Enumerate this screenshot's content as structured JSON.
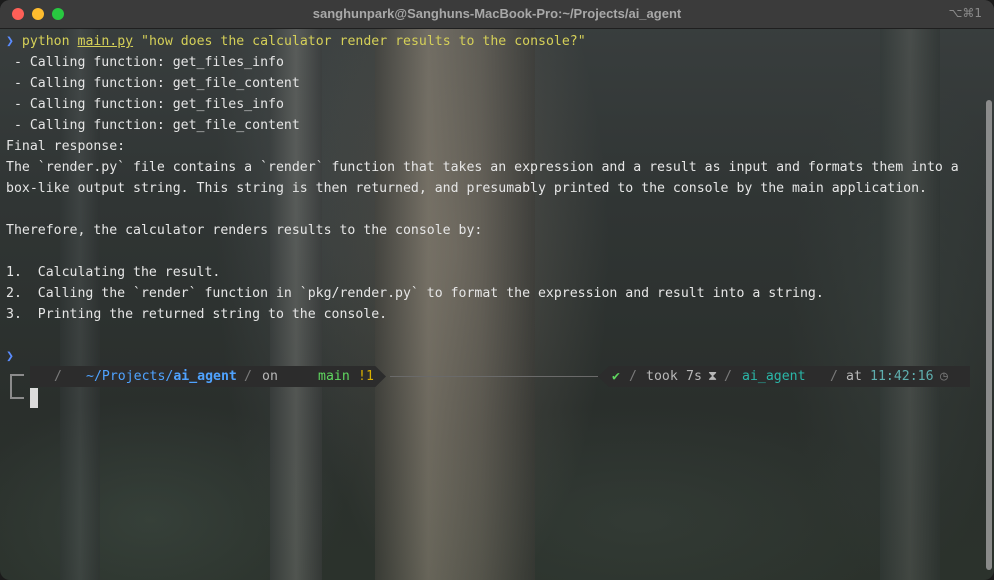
{
  "window": {
    "title": "sanghunpark@Sanghuns-MacBook-Pro:~/Projects/ai_agent",
    "shortcut": "⌥⌘1"
  },
  "command": {
    "prompt_symbol": "❯",
    "program": "python",
    "script": "main.py",
    "argument": "\"how does the calculator render results to the console?\""
  },
  "output_lines": [
    " - Calling function: get_files_info",
    " - Calling function: get_file_content",
    " - Calling function: get_files_info",
    " - Calling function: get_file_content",
    "Final response:",
    "The `render.py` file contains a `render` function that takes an expression and a result as input and formats them into a",
    "box-like output string. This string is then returned, and presumably printed to the console by the main application.",
    "",
    "Therefore, the calculator renders results to the console by:",
    "",
    "1.  Calculating the result.",
    "2.  Calling the `render` function in `pkg/render.py` to format the expression and result into a string.",
    "3.  Printing the returned string to the console."
  ],
  "second_prompt_symbol": "❯",
  "prompt_bar": {
    "os_icon": "",
    "folder_icon": "",
    "path_prefix": "~/Projects/",
    "path_dir": "ai_agent",
    "on_label": "on",
    "git_icon": "",
    "branch_icon": "",
    "branch": "main",
    "git_status": "!1",
    "check": "✔",
    "took_label": "took",
    "duration": "7s",
    "hourglass": "⧗",
    "env_name": "ai_agent",
    "python_icon": "",
    "at_label": "at",
    "time": "11:42:16",
    "clock_icon": "◷"
  },
  "colors": {
    "arrow": "#5a8cff",
    "command": "#d5d058",
    "path": "#4fa3ff",
    "branch": "#5fd75f",
    "git_dirty": "#d7af00",
    "env": "#2ab7a8",
    "time": "#5fafaf"
  }
}
